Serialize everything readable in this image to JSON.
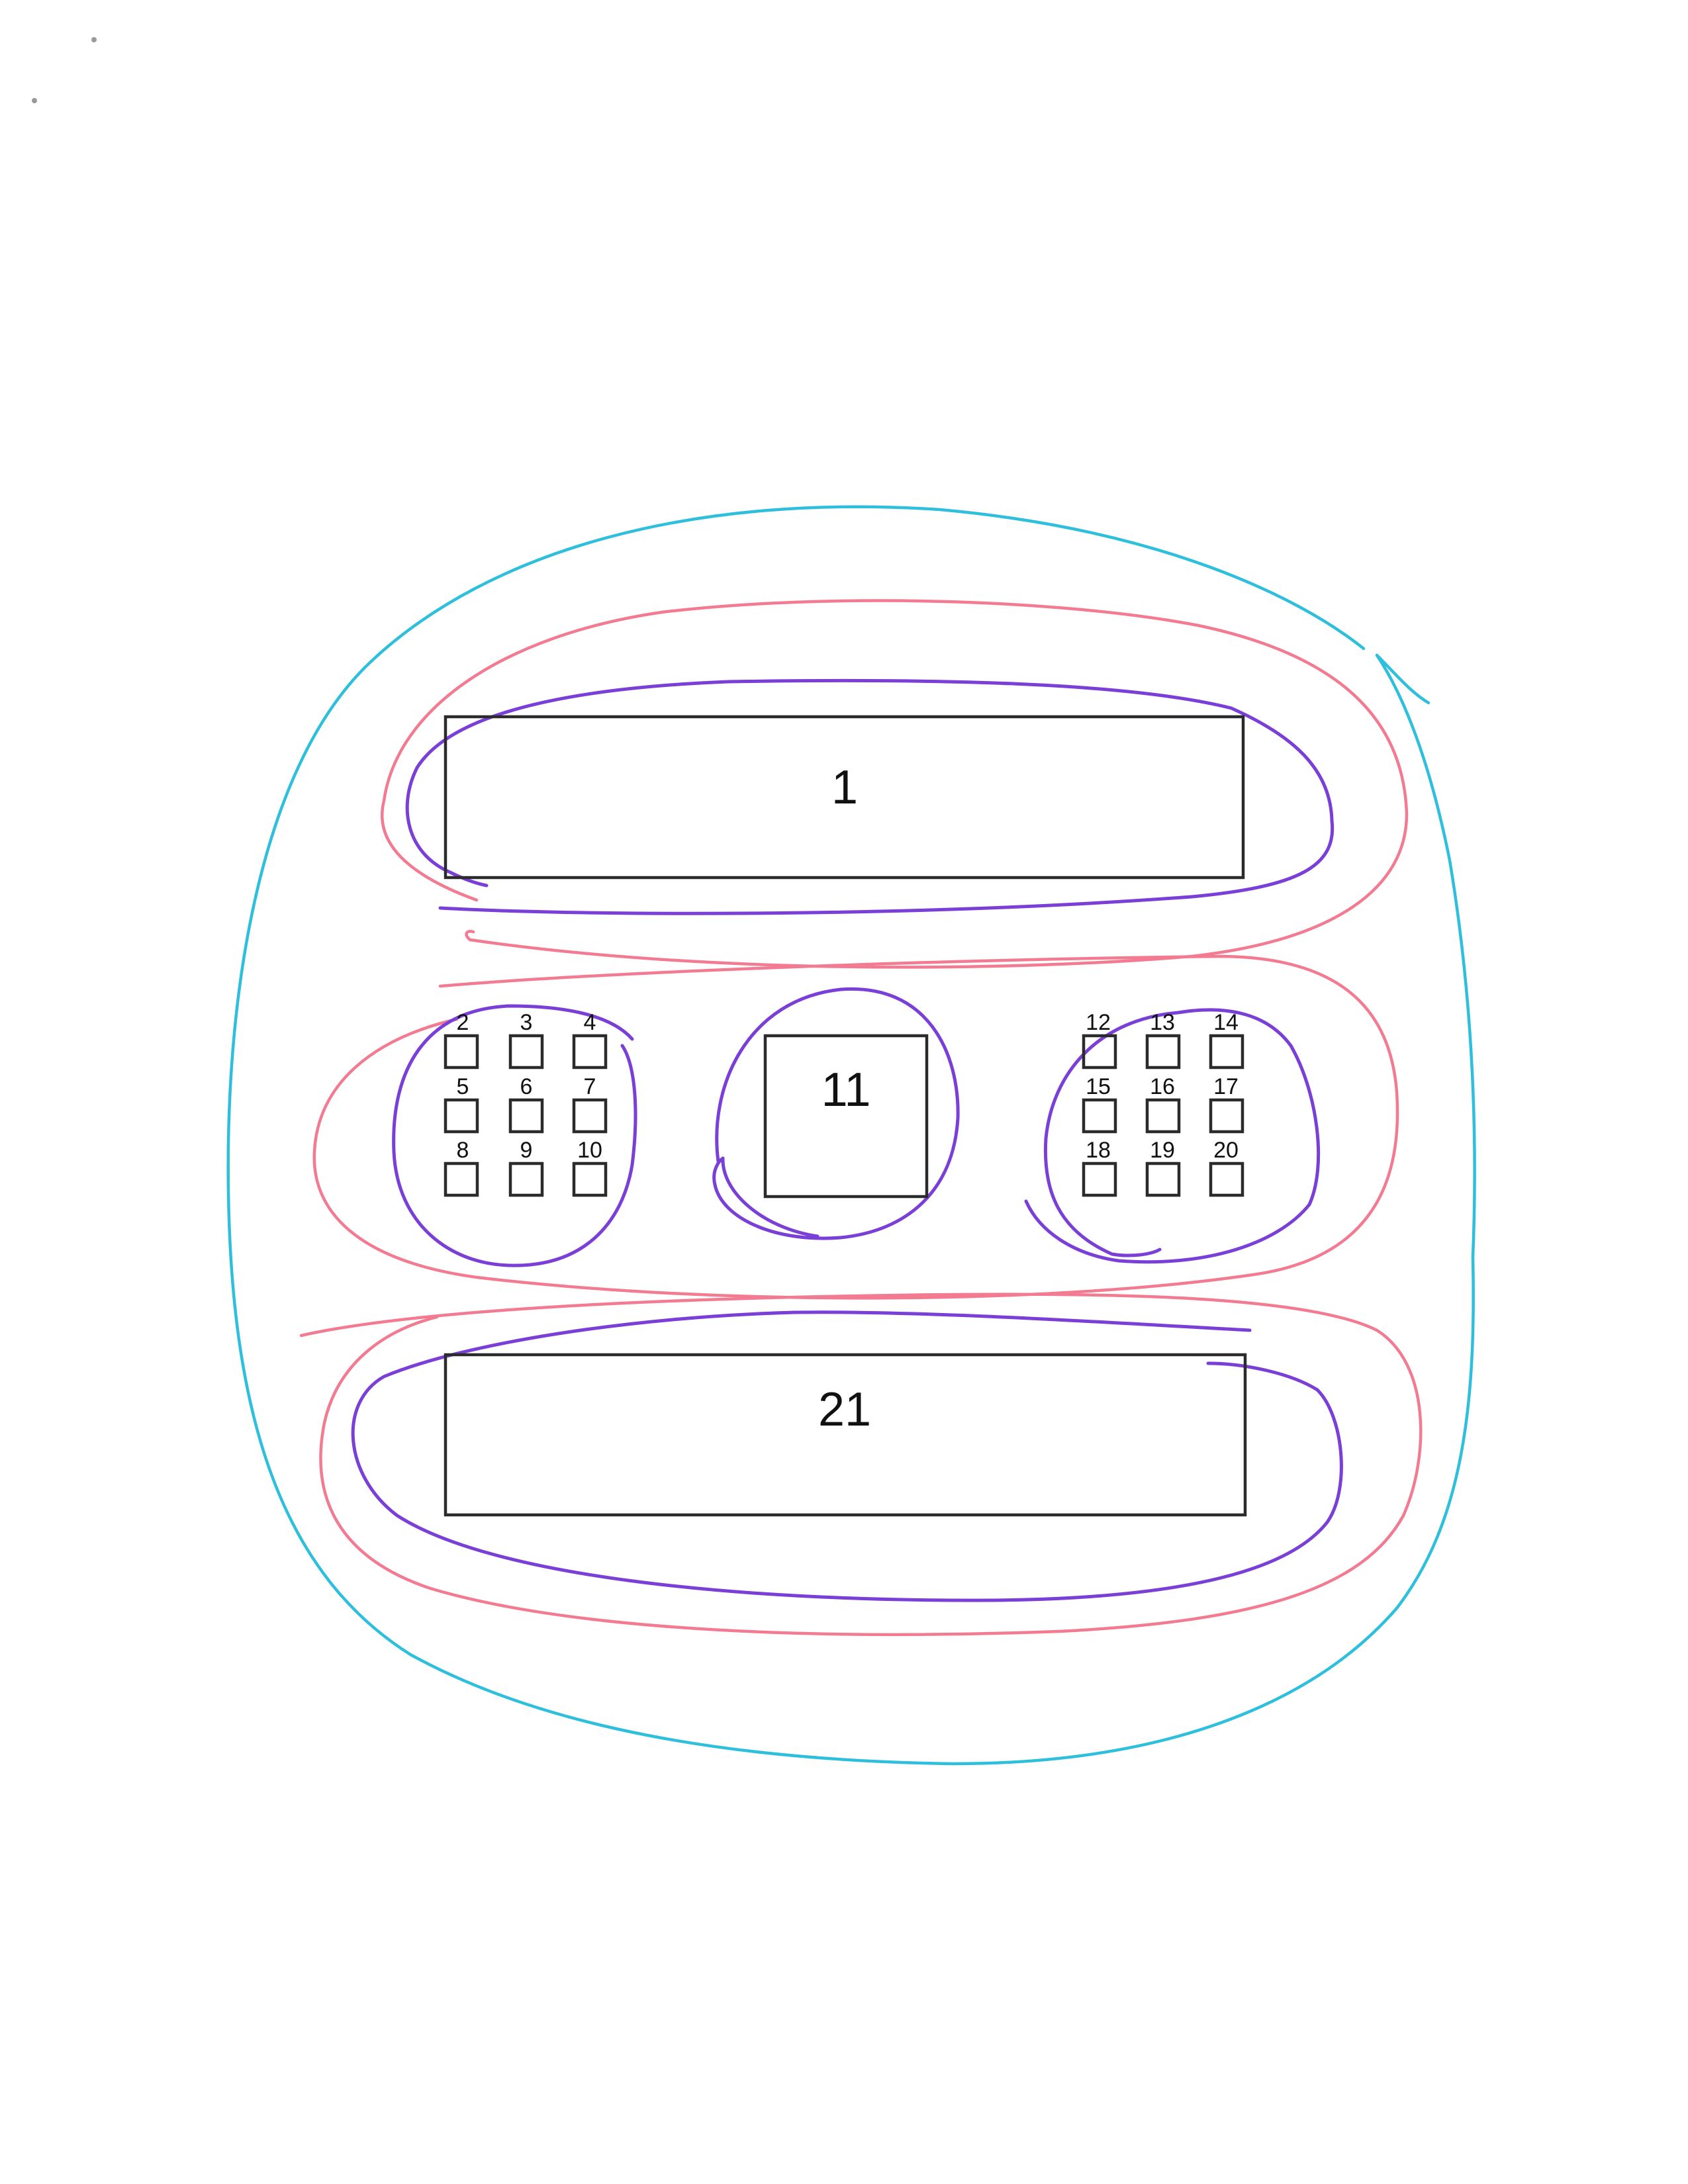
{
  "diagram": {
    "large_boxes": [
      {
        "id": "box-1",
        "label": "1"
      },
      {
        "id": "box-11",
        "label": "11"
      },
      {
        "id": "box-21",
        "label": "21"
      }
    ],
    "left_grid": [
      "2",
      "3",
      "4",
      "5",
      "6",
      "7",
      "8",
      "9",
      "10"
    ],
    "right_grid": [
      "12",
      "13",
      "14",
      "15",
      "16",
      "17",
      "18",
      "19",
      "20"
    ],
    "colors": {
      "box_stroke": "#2b2b2b",
      "outer_loop": "#2ebfdc",
      "middle_loops": "#f27b92",
      "inner_loops": "#7a3fd6"
    }
  }
}
